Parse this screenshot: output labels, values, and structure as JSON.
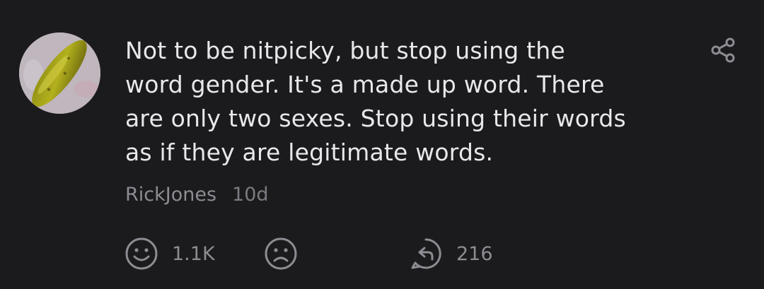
{
  "comment": {
    "lines": [
      "Not to be nitpicky, but stop using the",
      "word gender. It's a made up word. There",
      "are only two sexes. Stop using their words",
      "as if they are legitimate words."
    ],
    "author": "RickJones",
    "time": "10d",
    "likes": "1.1K",
    "replies": "216",
    "avatar_icon": "pickle-avatar",
    "share_icon": "share-icon"
  },
  "colors": {
    "background": "#1b1b1e",
    "text": "#e8e8eb",
    "muted": "#8c8c92"
  }
}
